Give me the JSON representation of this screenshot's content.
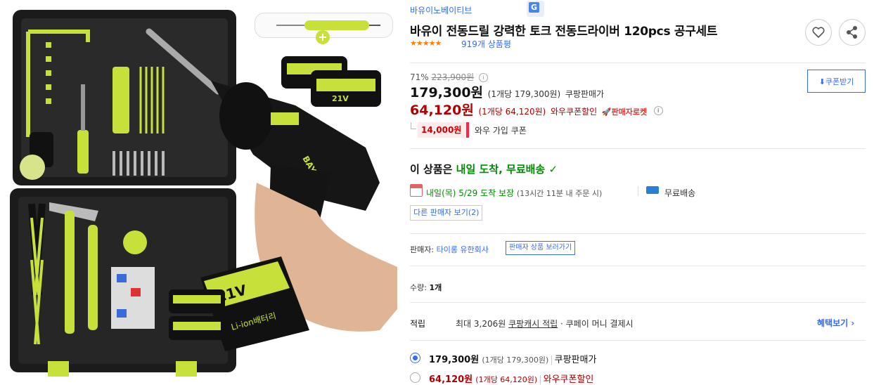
{
  "brand": "바유이노베이티브",
  "title": "바유이 전동드릴 강력한 토크 전동드라이버 120pcs 공구세트",
  "rating": {
    "stars": "★★★★★",
    "reviews": "919개 상품평"
  },
  "image": {
    "battery_text": "21V",
    "battery_sub": "Li-ion배터리",
    "drill_brand": "BAYU"
  },
  "price": {
    "discount_rate": "71%",
    "original": "223,900원",
    "sale": "179,300원",
    "sale_unit": "(1개당 179,300원)",
    "sale_seller": "쿠팡판매가",
    "wow": "64,120원",
    "wow_unit": "(1개당 64,120원)",
    "wow_label": "와우쿠폰할인",
    "rocket": "판매자로켓",
    "coupon_amount": "14,000원",
    "coupon_label": "와우 가입 쿠폰",
    "coupon_button": "쿠폰받기"
  },
  "delivery": {
    "headline_prefix": "이 상품은",
    "headline": "내일 도착, 무료배송",
    "check": "✓",
    "arrive": "내일(목) 5/29 도착 보장",
    "cutoff": "(13시간 11분 내 주문 시)",
    "free": "무료배송",
    "other_sellers": "다른 판매자 보기(2)"
  },
  "seller": {
    "label": "판매자:",
    "name": "타이롱 유한회사",
    "button": "판매자 상품 보러가기"
  },
  "quantity": {
    "label": "수량:",
    "value": "1개"
  },
  "reward": {
    "label": "적립",
    "prefix": "최대 3,206원",
    "link": "쿠팡캐시 적립",
    "suffix": "· 쿠페이 머니 결제시",
    "benefit": "혜택보기 ›"
  },
  "options": [
    {
      "price": "179,300원",
      "unit": "(1개당 179,300원)",
      "label": "쿠팡판매가",
      "selected": true
    },
    {
      "price": "64,120원",
      "unit": "(1개당 64,120원)",
      "label": "와우쿠폰할인",
      "selected": false
    }
  ],
  "colors": {
    "accent": "#346aff",
    "wow_red": "#ae0000",
    "green": "#008c00",
    "lime": "#c8e03a"
  }
}
